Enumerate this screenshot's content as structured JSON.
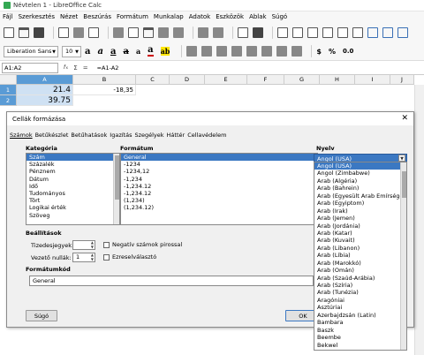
{
  "window": {
    "title": "Névtelen 1 - LibreOffice Calc"
  },
  "menu": [
    "Fájl",
    "Szerkesztés",
    "Nézet",
    "Beszúrás",
    "Formátum",
    "Munkalap",
    "Adatok",
    "Eszközök",
    "Ablak",
    "Súgó"
  ],
  "toolbar": {
    "font_name": "Liberation Sans",
    "font_size": "10"
  },
  "formula_bar": {
    "cell_ref": "A1:A2",
    "formula": "=A1-A2"
  },
  "sheet": {
    "columns": [
      "A",
      "B",
      "C",
      "D",
      "E",
      "F",
      "G",
      "H",
      "I",
      "J"
    ],
    "rows": [
      "1",
      "2"
    ],
    "cells": {
      "a1": "21.4",
      "a2": "39.75",
      "b1": "-18,35"
    }
  },
  "dialog": {
    "title": "Cellák formázása",
    "tabs": [
      "Számok",
      "Betűkészlet",
      "Betűhatások",
      "Igazítás",
      "Szegélyek",
      "Háttér",
      "Cellavédelem"
    ],
    "category_label": "Kategória",
    "categories": [
      "Szám",
      "Százalék",
      "Pénznem",
      "Dátum",
      "Idő",
      "Tudományos",
      "Tört",
      "Logikai érték",
      "Szöveg"
    ],
    "format_label": "Formátum",
    "formats": [
      "General",
      "-1234",
      "-1234,12",
      "-1,234",
      "-1,234.12",
      "-1,234.12",
      "(1,234)",
      "(1,234.12)"
    ],
    "language_label": "Nyelv",
    "language_value": "Angol (USA)",
    "options_label": "Beállítások",
    "decimals_label": "Tizedesjegyek:",
    "decimals_value": "",
    "leading_zeros_label": "Vezető nullák:",
    "leading_zeros_value": "1",
    "negative_red_label": "Negatív számok pirossal",
    "thousands_label": "Ezreselválasztó",
    "format_code_label": "Formátumkód",
    "format_code_value": "General",
    "help_button": "Súgó",
    "ok_button": "OK"
  },
  "language_list": [
    "Angol (USA)",
    "Angol (Zimbabwe)",
    "Arab (Algéria)",
    "Arab (Bahrein)",
    "Arab (Egyesült Arab Emírségek)",
    "Arab (Egyiptom)",
    "Arab (Irak)",
    "Arab (Jemen)",
    "Arab (Jordánia)",
    "Arab (Katar)",
    "Arab (Kuvait)",
    "Arab (Libanon)",
    "Arab (Líbia)",
    "Arab (Marokkó)",
    "Arab (Omán)",
    "Arab (Szaúd-Arábia)",
    "Arab (Szíria)",
    "Arab (Tunézia)",
    "Aragóniai",
    "Asztúriai",
    "Azerbajdzsán (Latin)",
    "Bambara",
    "Baszk",
    "Beembe",
    "Bekwel"
  ]
}
